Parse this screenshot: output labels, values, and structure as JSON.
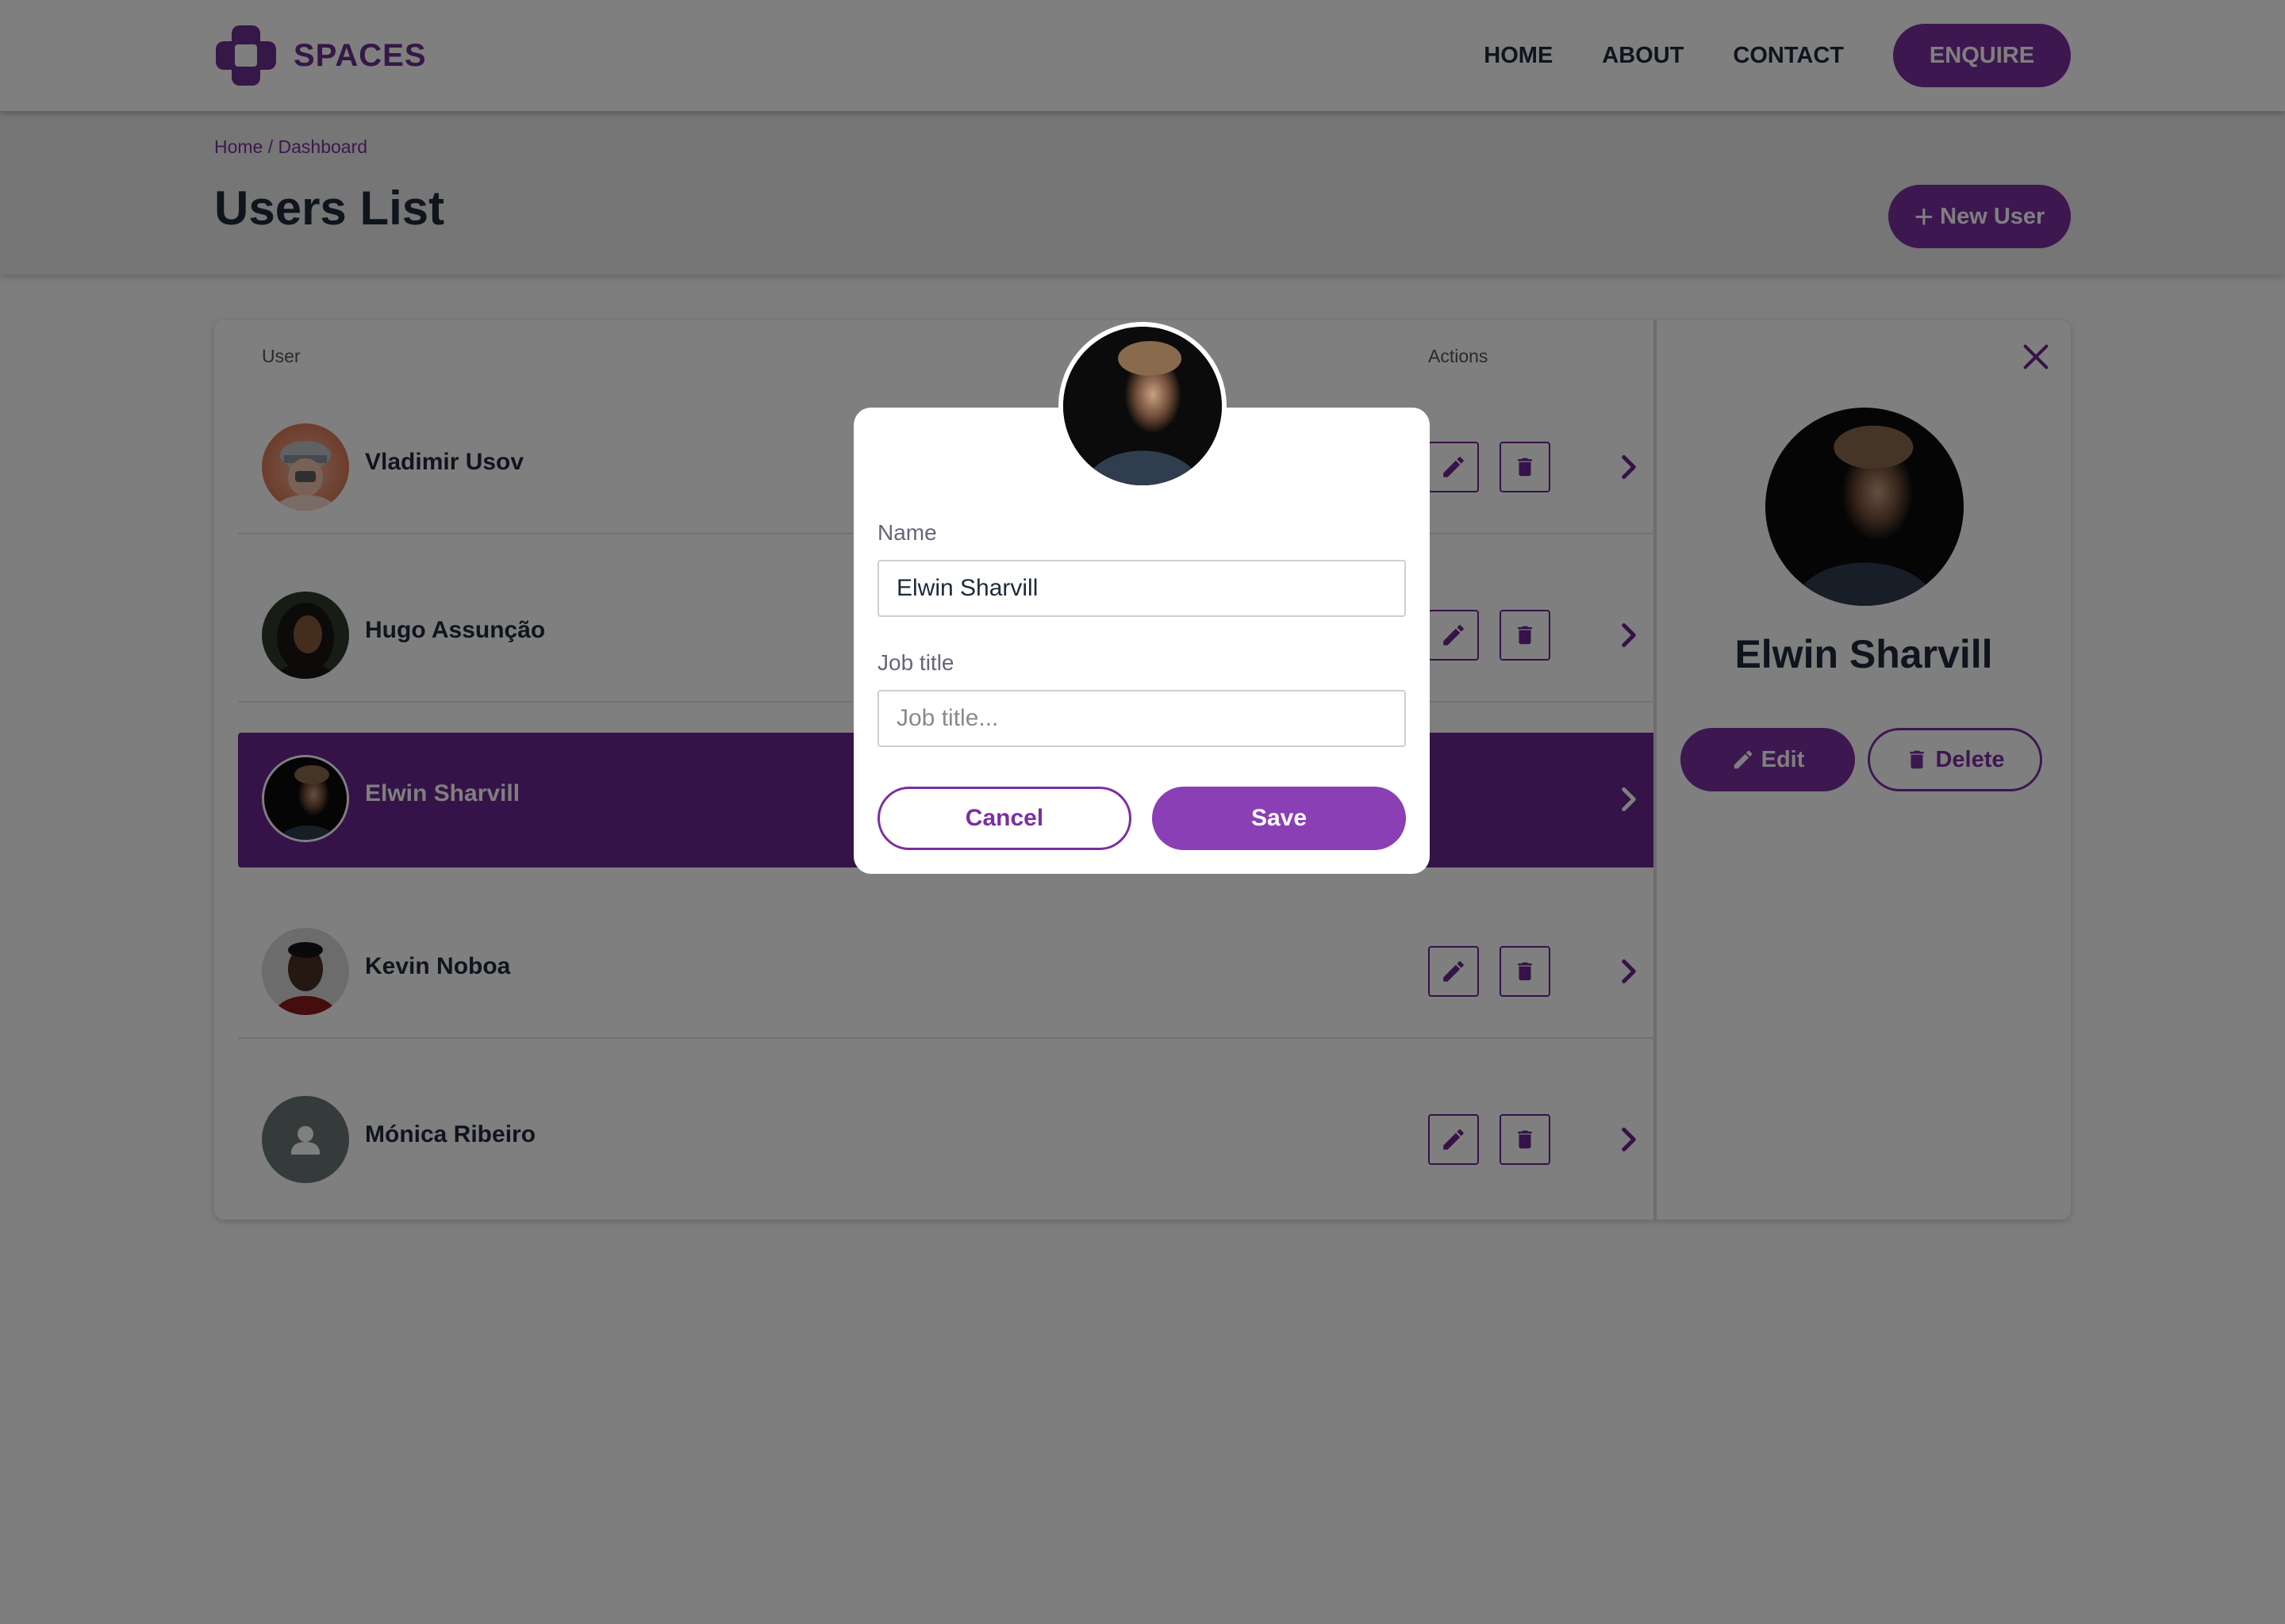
{
  "brand": {
    "name": "SPACES",
    "logo_icon": "brand-logo-icon"
  },
  "nav": {
    "items": [
      "HOME",
      "ABOUT",
      "CONTACT"
    ],
    "enquire_label": "ENQUIRE"
  },
  "breadcrumb": {
    "home": "Home",
    "separator": " / ",
    "current": "Dashboard"
  },
  "page": {
    "title": "Users List",
    "new_user_label": "New User"
  },
  "table": {
    "headers": {
      "user": "User",
      "actions": "Actions"
    },
    "rows": [
      {
        "name": "Vladimir Usov",
        "selected": false
      },
      {
        "name": "Hugo Assunção",
        "selected": false
      },
      {
        "name": "Elwin Sharvill",
        "selected": true
      },
      {
        "name": "Kevin Noboa",
        "selected": false
      },
      {
        "name": "Mónica Ribeiro",
        "selected": false
      }
    ]
  },
  "detail": {
    "name": "Elwin Sharvill",
    "edit_label": "Edit",
    "delete_label": "Delete"
  },
  "modal": {
    "name_label": "Name",
    "name_value": "Elwin Sharvill",
    "job_label": "Job title",
    "job_placeholder": "Job title...",
    "cancel_label": "Cancel",
    "save_label": "Save"
  },
  "colors": {
    "accent": "#7b2fa0",
    "selected_row": "#6a2591",
    "text_dark": "#1e293b"
  }
}
